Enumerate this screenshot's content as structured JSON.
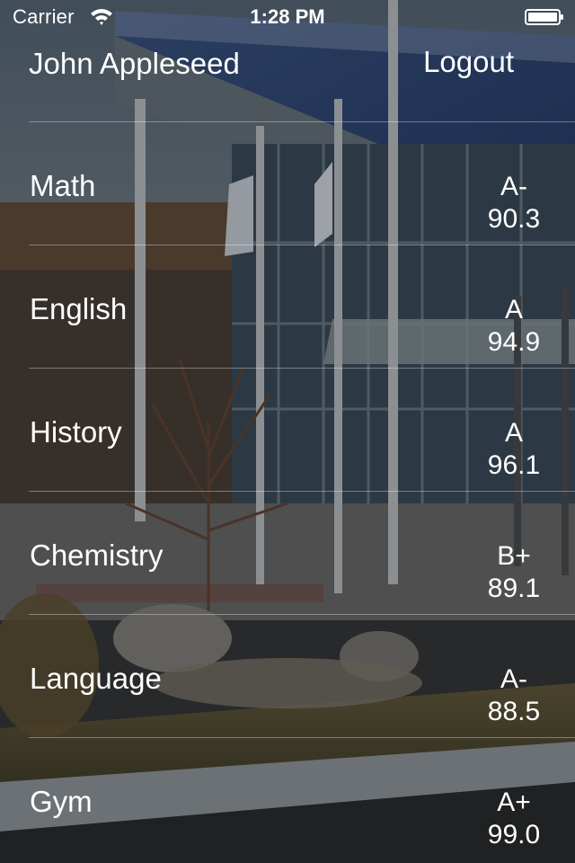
{
  "status_bar": {
    "carrier": "Carrier",
    "time": "1:28 PM",
    "wifi_icon": "wifi-icon",
    "battery_icon": "battery-icon"
  },
  "header": {
    "user_name": "John Appleseed",
    "logout_label": "Logout"
  },
  "grades": [
    {
      "subject": "Math",
      "letter": "A-",
      "score": "90.3"
    },
    {
      "subject": "English",
      "letter": "A",
      "score": "94.9"
    },
    {
      "subject": "History",
      "letter": "A",
      "score": "96.1"
    },
    {
      "subject": "Chemistry",
      "letter": "B+",
      "score": "89.1"
    },
    {
      "subject": "Language",
      "letter": "A-",
      "score": "88.5"
    },
    {
      "subject": "Gym",
      "letter": "A+",
      "score": "99.0"
    }
  ],
  "colors": {
    "text": "#ffffff",
    "divider": "rgba(255,255,255,0.35)",
    "overlay": "rgba(0,0,0,0.35)"
  }
}
